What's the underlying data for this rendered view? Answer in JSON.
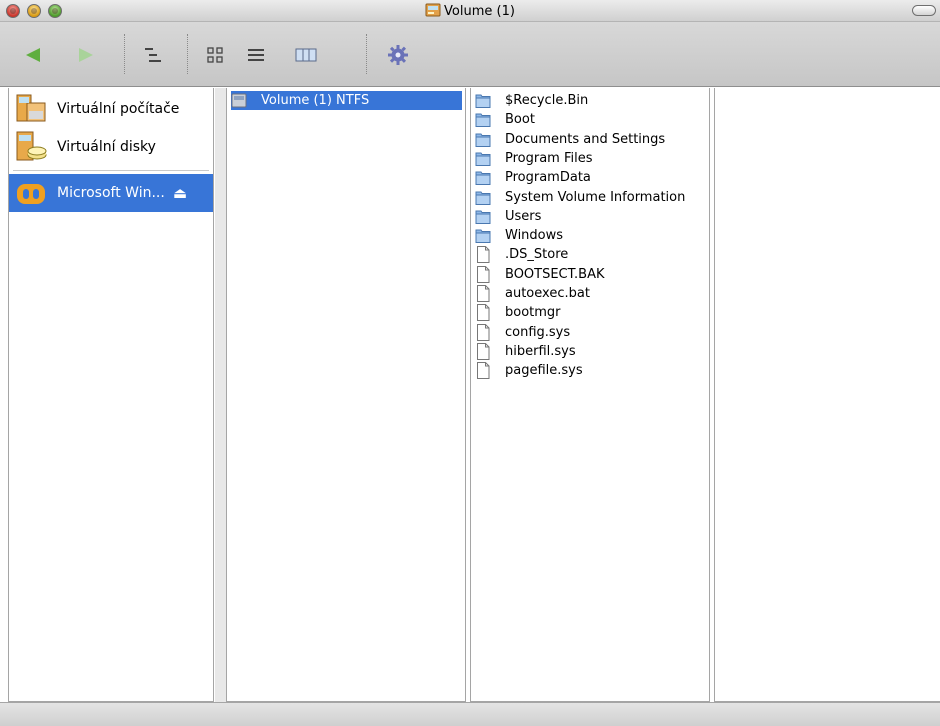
{
  "window": {
    "title": "Volume (1)",
    "title_icon": "drive-icon"
  },
  "toolbar": {
    "back": "back-arrow-icon",
    "forward": "forward-arrow-icon",
    "hierarchy": "hierarchy-view-icon",
    "icon_view": "icon-view-icon",
    "list_view": "list-view-icon",
    "column_view": "column-view-icon",
    "action": "gear-icon"
  },
  "sidebar": {
    "items": [
      {
        "label": "Virtuální počítače",
        "icon": "virtual-machines-icon"
      },
      {
        "label": "Virtuální disky",
        "icon": "virtual-disks-icon"
      }
    ],
    "mounted": {
      "label": "Microsoft Win...",
      "icon": "parallels-logo-icon",
      "eject": "⏏"
    }
  },
  "columns": {
    "volume": {
      "label": "Volume (1) NTFS",
      "icon": "volume-icon"
    },
    "files": [
      {
        "name": "$Recycle.Bin",
        "kind": "folder"
      },
      {
        "name": "Boot",
        "kind": "folder"
      },
      {
        "name": "Documents and Settings",
        "kind": "folder"
      },
      {
        "name": "Program Files",
        "kind": "folder"
      },
      {
        "name": "ProgramData",
        "kind": "folder"
      },
      {
        "name": "System Volume Information",
        "kind": "folder"
      },
      {
        "name": "Users",
        "kind": "folder"
      },
      {
        "name": "Windows",
        "kind": "folder"
      },
      {
        "name": ".DS_Store",
        "kind": "file"
      },
      {
        "name": "BOOTSECT.BAK",
        "kind": "file"
      },
      {
        "name": "autoexec.bat",
        "kind": "file"
      },
      {
        "name": "bootmgr",
        "kind": "file"
      },
      {
        "name": "config.sys",
        "kind": "file"
      },
      {
        "name": "hiberfil.sys",
        "kind": "file"
      },
      {
        "name": "pagefile.sys",
        "kind": "file"
      }
    ]
  },
  "colors": {
    "selection": "#3875d7",
    "folder": "#8fb8e8"
  }
}
